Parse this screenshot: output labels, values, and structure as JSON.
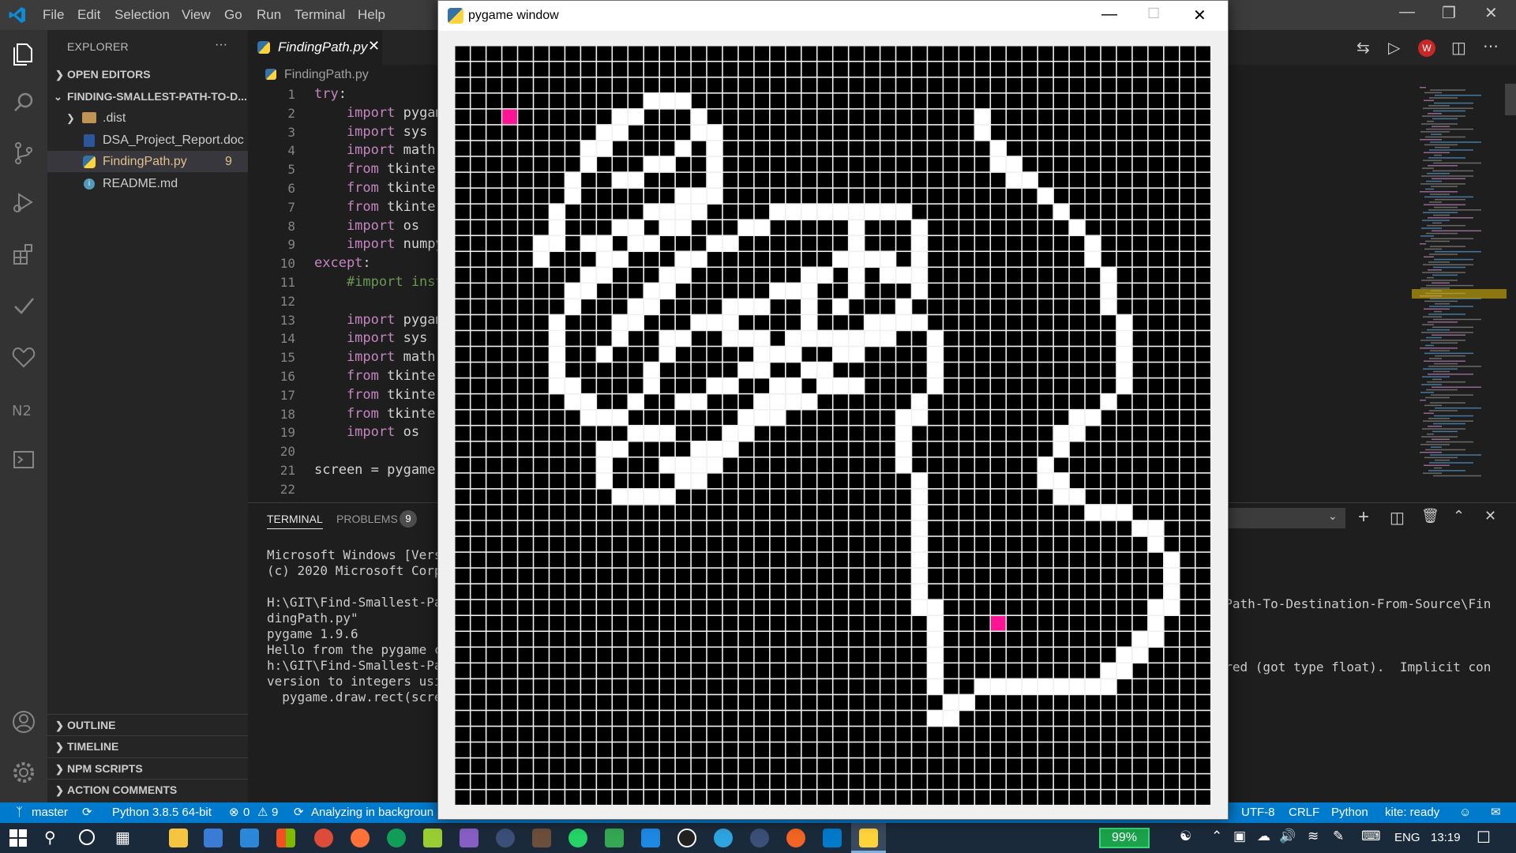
{
  "titlebar": {
    "menu": [
      "File",
      "Edit",
      "Selection",
      "View",
      "Go",
      "Run",
      "Terminal",
      "Help"
    ]
  },
  "sidebar": {
    "title": "EXPLORER",
    "more": "···",
    "open_editors": "OPEN EDITORS",
    "folder": "FINDING-SMALLEST-PATH-TO-D...",
    "items": [
      {
        "label": ".dist",
        "icon": "folder-icon"
      },
      {
        "label": "DSA_Project_Report.doc",
        "icon": "word-doc-icon"
      },
      {
        "label": "FindingPath.py",
        "icon": "python-icon",
        "badge": "9"
      },
      {
        "label": "README.md",
        "icon": "info-icon"
      }
    ],
    "sections": [
      "OUTLINE",
      "TIMELINE",
      "NPM SCRIPTS",
      "ACTION COMMENTS"
    ]
  },
  "editor": {
    "tab_label": "FindingPath.py",
    "breadcrumb": "FindingPath.py",
    "line_numbers": [
      "1",
      "2",
      "3",
      "4",
      "5",
      "6",
      "7",
      "8",
      "9",
      "10",
      "11",
      "12",
      "13",
      "14",
      "15",
      "16",
      "17",
      "18",
      "19",
      "20",
      "21",
      "22"
    ],
    "lines": [
      {
        "kw": "try",
        "rest": ":"
      },
      {
        "kw": "    import",
        "rest": " pygam"
      },
      {
        "kw": "    import",
        "rest": " sys"
      },
      {
        "kw": "    import",
        "rest": " math"
      },
      {
        "kw": "    from",
        "rest": " tkinter"
      },
      {
        "kw": "    from",
        "rest": " tkinter"
      },
      {
        "kw": "    from",
        "rest": " tkinter"
      },
      {
        "kw": "    import",
        "rest": " os"
      },
      {
        "kw": "    import",
        "rest": " numpy"
      },
      {
        "kw": "except",
        "rest": ":"
      },
      {
        "kw": "",
        "rest": "",
        "comment": "    #import inst"
      },
      {
        "kw": "",
        "rest": ""
      },
      {
        "kw": "    import",
        "rest": " pygam"
      },
      {
        "kw": "    import",
        "rest": " sys"
      },
      {
        "kw": "    import",
        "rest": " math"
      },
      {
        "kw": "    from",
        "rest": " tkinter"
      },
      {
        "kw": "    from",
        "rest": " tkinter"
      },
      {
        "kw": "    from",
        "rest": " tkinter"
      },
      {
        "kw": "    import",
        "rest": " os"
      },
      {
        "kw": "",
        "rest": ""
      },
      {
        "kw": "",
        "rest": "screen = pygame."
      },
      {
        "kw": "",
        "rest": ""
      }
    ]
  },
  "panel": {
    "tabs": [
      "TERMINAL",
      "PROBLEMS"
    ],
    "problems_count": "9",
    "terminal_left": [
      "Microsoft Windows [Versi",
      "(c) 2020 Microsoft Corpo",
      "",
      "H:\\GIT\\Find-Smallest-Pat",
      "dingPath.py\"",
      "pygame 1.9.6",
      "Hello from the pygame co",
      "h:\\GIT\\Find-Smallest-Pat",
      "version to integers usin",
      "  pygame.draw.rect(scree"
    ],
    "terminal_right_1": "t-Path-To-Destination-From-Source\\Fin",
    "terminal_right_2": "uired (got type float).  Implicit con"
  },
  "statusbar": {
    "branch": "master",
    "python": "Python 3.8.5 64-bit",
    "errors": "0",
    "warnings": "9",
    "analyzing": "Analyzing in backgroun",
    "encoding": "UTF-8",
    "eol": "CRLF",
    "language": "Python",
    "kite": "kite: ready"
  },
  "taskbar": {
    "battery": "99%",
    "lang": "ENG",
    "time": "13:19"
  },
  "pygame": {
    "title": "pygame window",
    "grid": {
      "cols": 48,
      "rows": 48,
      "wall_color": "#000000",
      "path_color": "#ffffff",
      "endpoint_color": "#ff1493"
    },
    "endpoints": [
      {
        "label": "source",
        "col": 3,
        "row": 4
      },
      {
        "label": "destination",
        "col": 34,
        "row": 36
      }
    ]
  }
}
